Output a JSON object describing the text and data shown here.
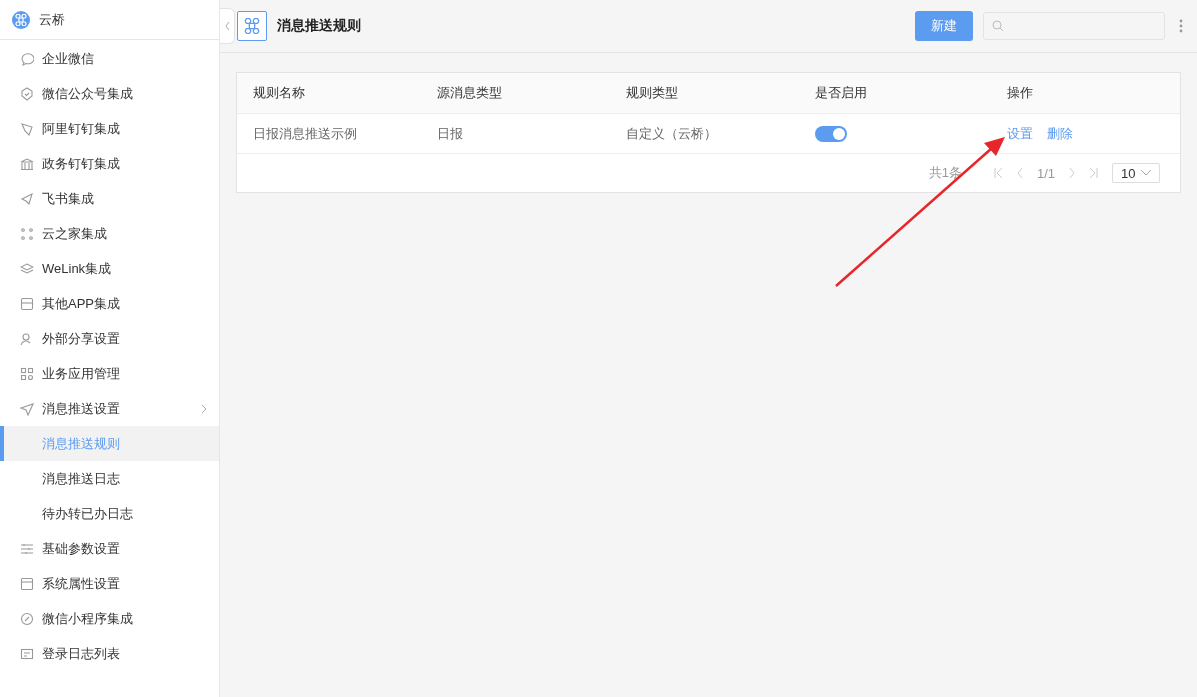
{
  "app": {
    "name": "云桥"
  },
  "sidebar": {
    "items": [
      {
        "label": "企业微信",
        "selected": false
      },
      {
        "label": "微信公众号集成",
        "selected": false
      },
      {
        "label": "阿里钉钉集成",
        "selected": false
      },
      {
        "label": "政务钉钉集成",
        "selected": false
      },
      {
        "label": "飞书集成",
        "selected": false
      },
      {
        "label": "云之家集成",
        "selected": false
      },
      {
        "label": "WeLink集成",
        "selected": false
      },
      {
        "label": "其他APP集成",
        "selected": false
      },
      {
        "label": "外部分享设置",
        "selected": false
      },
      {
        "label": "业务应用管理",
        "selected": false
      },
      {
        "label": "消息推送设置",
        "selected": false,
        "expanded": true,
        "children": [
          {
            "label": "消息推送规则",
            "selected": true
          },
          {
            "label": "消息推送日志",
            "selected": false
          },
          {
            "label": "待办转已办日志",
            "selected": false
          }
        ]
      },
      {
        "label": "基础参数设置",
        "selected": false
      },
      {
        "label": "系统属性设置",
        "selected": false
      },
      {
        "label": "微信小程序集成",
        "selected": false
      },
      {
        "label": "登录日志列表",
        "selected": false
      }
    ]
  },
  "header": {
    "title": "消息推送规则",
    "new_button": "新建"
  },
  "table": {
    "columns": [
      "规则名称",
      "源消息类型",
      "规则类型",
      "是否启用",
      "操作"
    ],
    "rows": [
      {
        "name": "日报消息推送示例",
        "source_type": "日报",
        "rule_type": "自定义（云桥）",
        "enabled": true,
        "actions": [
          "设置",
          "删除"
        ]
      }
    ]
  },
  "pagination": {
    "total": "共1条",
    "page": "1/1",
    "page_size": "10"
  }
}
